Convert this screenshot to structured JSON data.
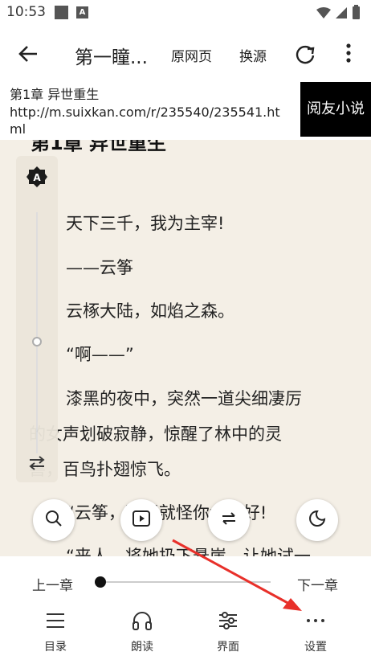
{
  "status": {
    "time": "10:53"
  },
  "toolbar": {
    "title": "第一瞳...",
    "original_page": "原网页",
    "change_source": "换源"
  },
  "banner": {
    "chapter": "第1章 异世重生",
    "url": "http://m.suixkan.com/r/235540/235541.html",
    "reader_button": "阅友小说"
  },
  "content": {
    "cut_title": "第1章 异世重生",
    "paragraphs": [
      "天下三千，我为主宰!",
      "——云筝",
      "云椓大陆，如焰之森。",
      "“啊——”",
      "漆黑的夜中，突然一道尖细凄厉",
      "的女声划破寂静，惊醒了林中的灵",
      "兽，百鸟扑翅惊飞。",
      "“云筝，要怪就怪你命不好!",
      "“来人，将她扔下悬崖，让她试一"
    ]
  },
  "bottom": {
    "prev_chapter": "上一章",
    "next_chapter": "下一章",
    "progress": 0.0,
    "nav": [
      {
        "label": "目录",
        "icon": "list-icon"
      },
      {
        "label": "朗读",
        "icon": "headphones-icon"
      },
      {
        "label": "界面",
        "icon": "sliders-icon"
      },
      {
        "label": "设置",
        "icon": "more-horizontal-icon"
      }
    ]
  },
  "colors": {
    "accent_arrow": "#e8302a",
    "page_bg": "#f4efe6"
  }
}
